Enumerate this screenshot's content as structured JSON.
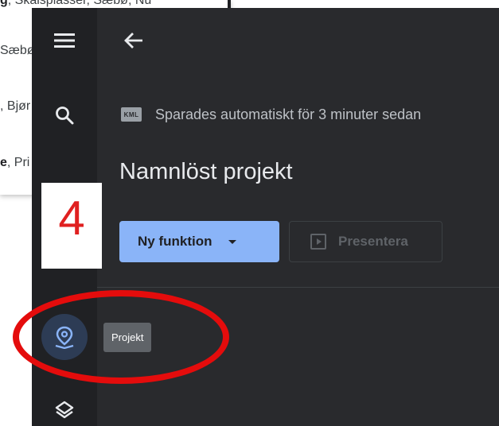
{
  "background": {
    "results": [
      {
        "bold": "g",
        "rest": ", Skaisplasser, Sæbø, Nu"
      },
      {
        "bold": "",
        "rest": "Sæbø"
      },
      {
        "bold": "",
        "rest": ", Bjør"
      },
      {
        "bold": "e",
        "rest": ", Pri"
      }
    ]
  },
  "rail": {
    "items": [
      {
        "icon": "menu-icon"
      },
      {
        "icon": "search-icon"
      },
      {
        "icon": "layers-icon"
      }
    ],
    "active_icon": "map-pin-icon",
    "tooltip": "Projekt"
  },
  "header": {
    "back_icon": "arrow-back-icon",
    "trash_icon": "trash-icon"
  },
  "save_status": {
    "badge": "KML",
    "text": "Sparades automatiskt för 3 minuter sedan"
  },
  "project_title": "Namnlöst projekt",
  "actions": {
    "new_feature": "Ny funktion",
    "present": "Presentera"
  },
  "annotation": {
    "step": "4"
  },
  "colors": {
    "accent": "#8ab4f8",
    "panel": "#292a2d",
    "rail": "#202124",
    "annotation_red": "#e40c0c"
  }
}
